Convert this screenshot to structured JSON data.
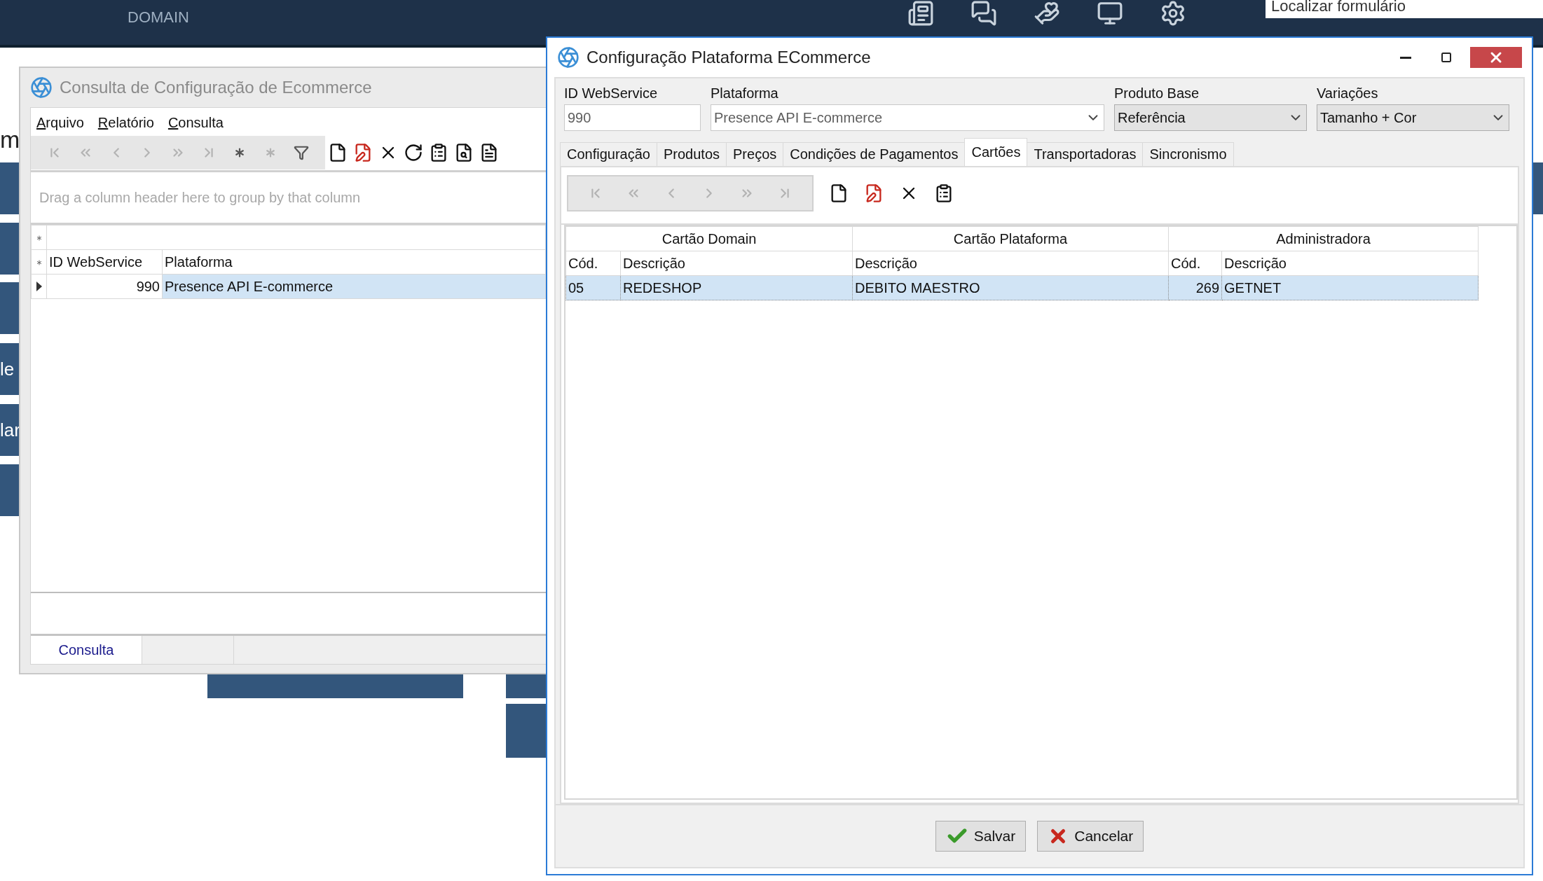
{
  "top_bar": {
    "logo_sub": "DOMAIN",
    "search": {
      "placeholder": "Localizar formulário"
    }
  },
  "desktop": {
    "texts": [
      "m"
    ],
    "tile_labels": [
      "le",
      "lar"
    ]
  },
  "consulta_window": {
    "title": "Consulta de Configuração de Ecommerce",
    "active": false,
    "menu": [
      "Arquivo",
      "Relatório",
      "Consulta"
    ],
    "nav_buttons": [
      {
        "kind": "first",
        "disabled": true
      },
      {
        "kind": "prev_page",
        "disabled": true
      },
      {
        "kind": "prev",
        "disabled": true
      },
      {
        "kind": "next",
        "disabled": true
      },
      {
        "kind": "next_page",
        "disabled": true
      },
      {
        "kind": "last",
        "disabled": true
      },
      {
        "kind": "insert",
        "disabled": false
      },
      {
        "kind": "insert",
        "disabled": true
      },
      {
        "kind": "filter",
        "disabled": false
      }
    ],
    "action_buttons": [
      {
        "kind": "new"
      },
      {
        "kind": "edit"
      },
      {
        "kind": "delete"
      },
      {
        "kind": "refresh"
      },
      {
        "kind": "properties"
      },
      {
        "kind": "preview"
      },
      {
        "kind": "report"
      }
    ],
    "group_hint": "Drag a column header here to group by that column",
    "columns": [
      "ID WebService",
      "Plataforma"
    ],
    "rows": [
      {
        "cells": [
          "990",
          "Presence API E-commerce"
        ],
        "selected": true
      }
    ],
    "footer_tabs": [
      {
        "label": "Consulta",
        "selected": true
      }
    ]
  },
  "config_window": {
    "title": "Configuração Plataforma ECommerce",
    "active": true,
    "fields": [
      {
        "label": "ID WebService",
        "kind": "text",
        "value": "990",
        "disabled": true
      },
      {
        "label": "Plataforma",
        "kind": "combo",
        "value": "Presence API E-commerce",
        "disabled": true
      },
      {
        "label": "Produto Base",
        "kind": "list",
        "value": "Referência",
        "disabled": false
      },
      {
        "label": "Variações",
        "kind": "list",
        "value": "Tamanho + Cor",
        "disabled": false
      }
    ],
    "tabs": [
      {
        "label": "Configuração",
        "selected": false
      },
      {
        "label": "Produtos",
        "selected": false
      },
      {
        "label": "Preços",
        "selected": false
      },
      {
        "label": "Condições de Pagamentos",
        "selected": false
      },
      {
        "label": "Cartões",
        "selected": true
      },
      {
        "label": "Transportadoras",
        "selected": false
      },
      {
        "label": "Sincronismo",
        "selected": false
      }
    ],
    "nav_buttons": [
      {
        "kind": "first",
        "disabled": true
      },
      {
        "kind": "prev_page",
        "disabled": true
      },
      {
        "kind": "prev",
        "disabled": true
      },
      {
        "kind": "next",
        "disabled": true
      },
      {
        "kind": "next_page",
        "disabled": true
      },
      {
        "kind": "last",
        "disabled": true
      }
    ],
    "action_buttons": [
      {
        "kind": "new"
      },
      {
        "kind": "edit"
      },
      {
        "kind": "delete"
      },
      {
        "kind": "properties"
      }
    ],
    "bands": [
      {
        "label": "Cartão Domain",
        "columns": [
          "Cód.",
          "Descrição"
        ]
      },
      {
        "label": "Cartão Plataforma",
        "columns": [
          "Descrição"
        ]
      },
      {
        "label": "Administradora",
        "columns": [
          "Cód.",
          "Descrição"
        ]
      }
    ],
    "rows": [
      {
        "cells": [
          "05",
          "REDESHOP",
          "DEBITO MAESTRO",
          "269",
          "GETNET"
        ],
        "selected": true
      }
    ],
    "buttons": [
      {
        "kind": "save",
        "label": "Salvar"
      },
      {
        "kind": "cancel",
        "label": "Cancelar"
      }
    ]
  }
}
